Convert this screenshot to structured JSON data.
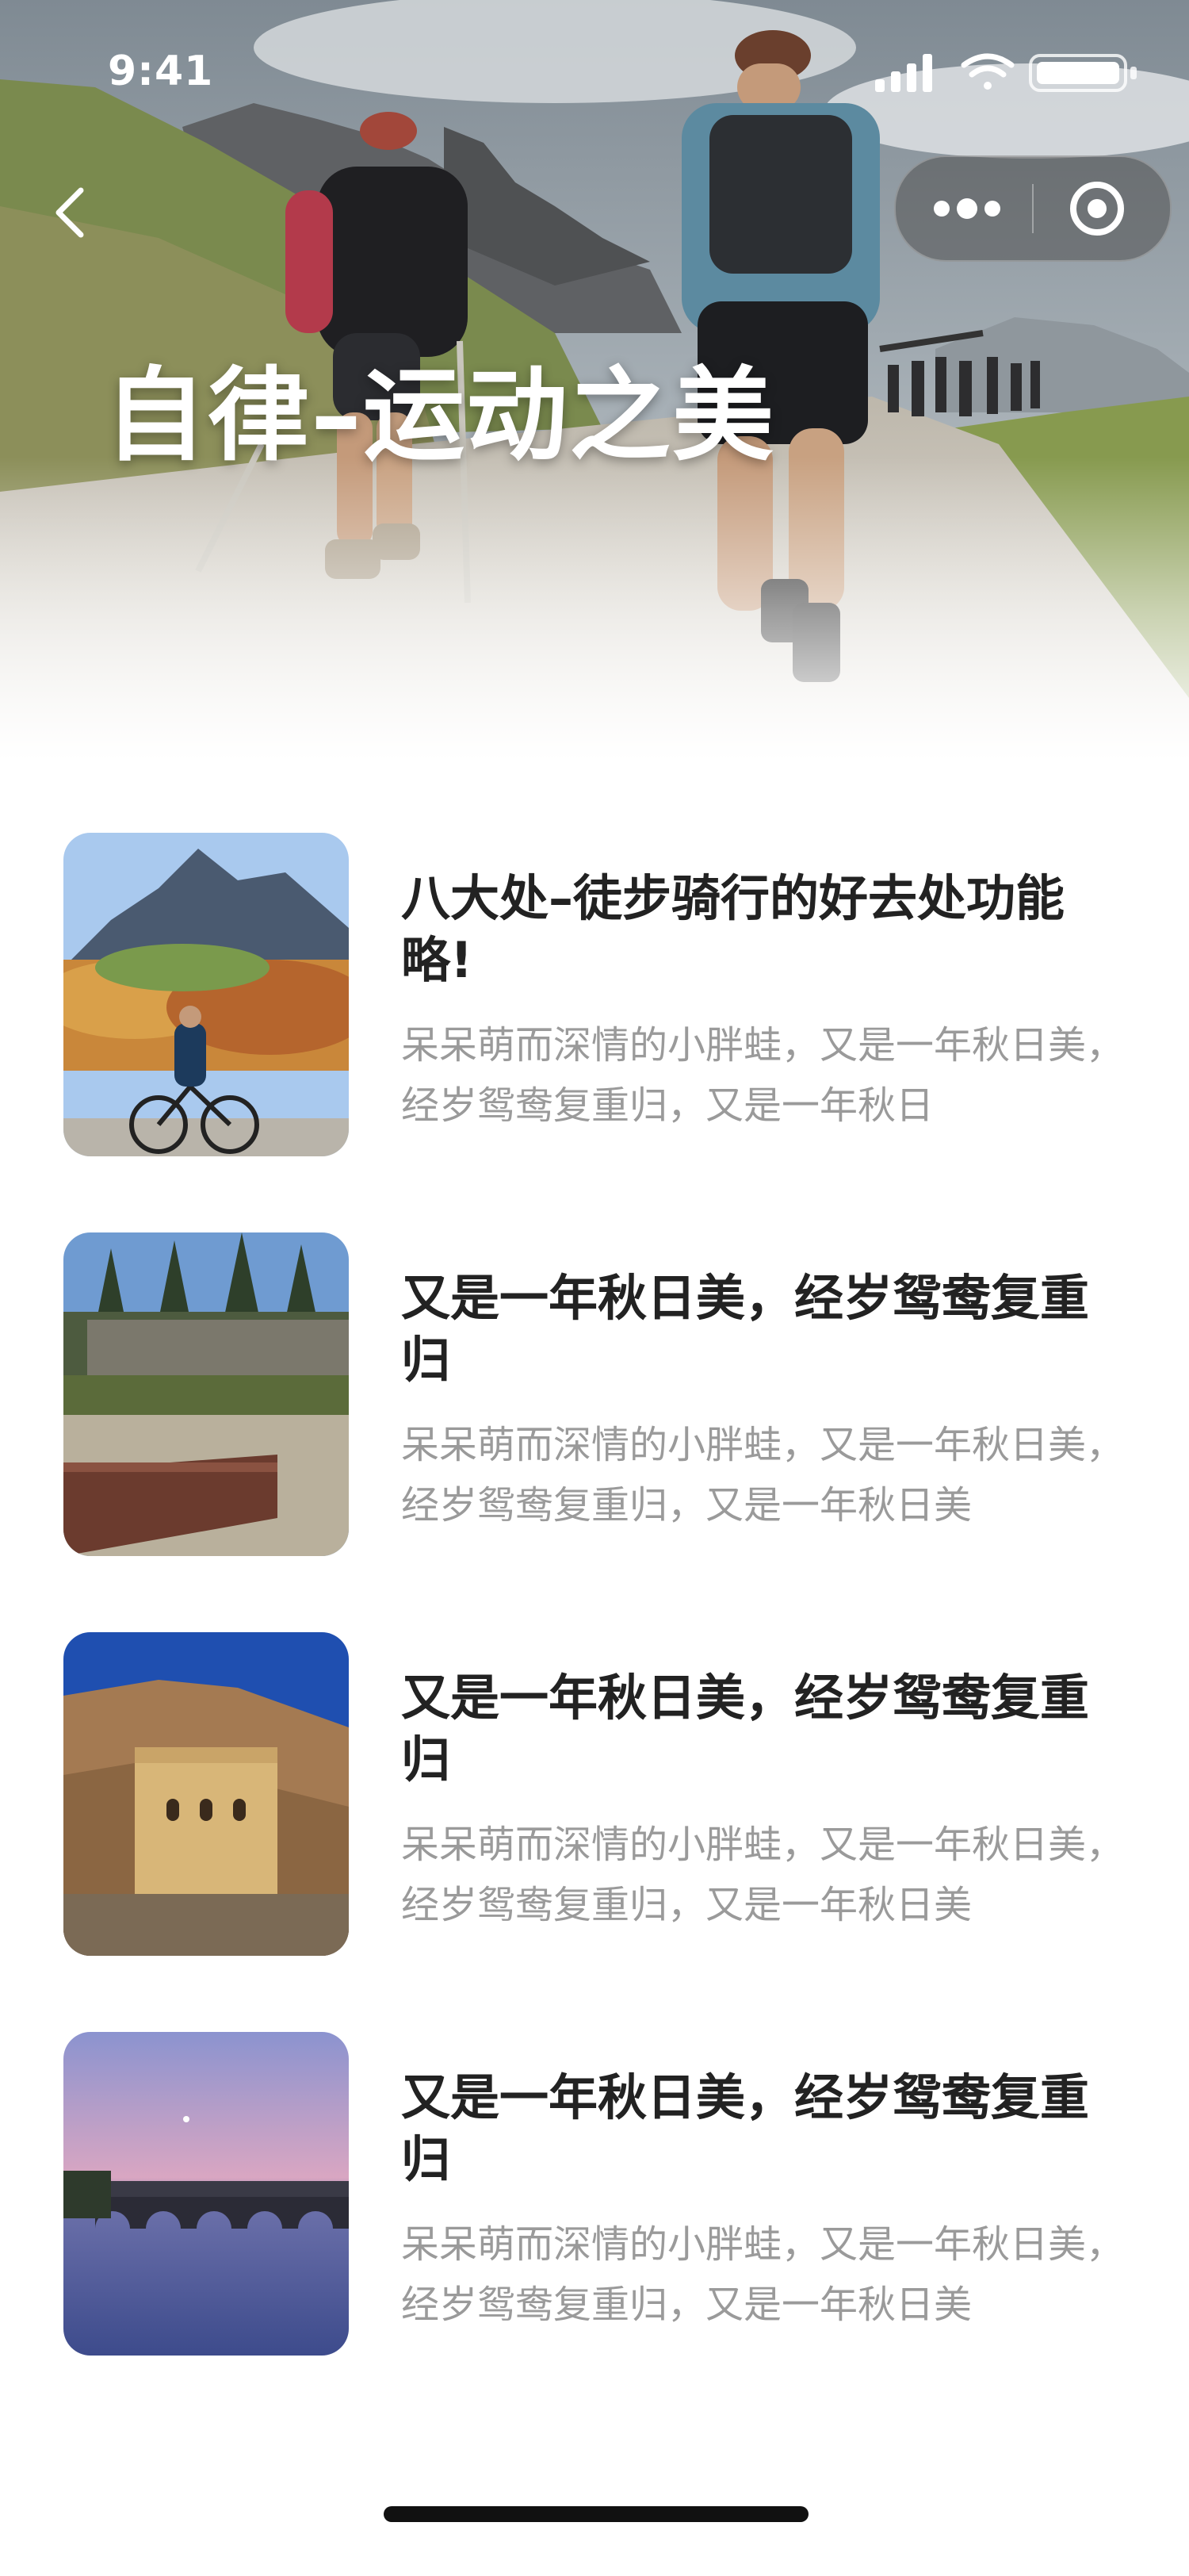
{
  "status_bar": {
    "time": "9:41"
  },
  "hero": {
    "title": "自律–运动之美"
  },
  "articles": [
    {
      "title": "八大处–徒步骑行的好去处功能略!",
      "desc": "呆呆萌而深情的小胖蛙，又是一年秋日美，经岁鸳鸯复重归，又是一年秋日"
    },
    {
      "title": "又是一年秋日美，经岁鸳鸯复重归",
      "desc": "呆呆萌而深情的小胖蛙，又是一年秋日美，经岁鸳鸯复重归，又是一年秋日美"
    },
    {
      "title": "又是一年秋日美，经岁鸳鸯复重归",
      "desc": "呆呆萌而深情的小胖蛙，又是一年秋日美，经岁鸳鸯复重归，又是一年秋日美"
    },
    {
      "title": "又是一年秋日美，经岁鸳鸯复重归",
      "desc": "呆呆萌而深情的小胖蛙，又是一年秋日美，经岁鸳鸯复重归，又是一年秋日美"
    }
  ]
}
